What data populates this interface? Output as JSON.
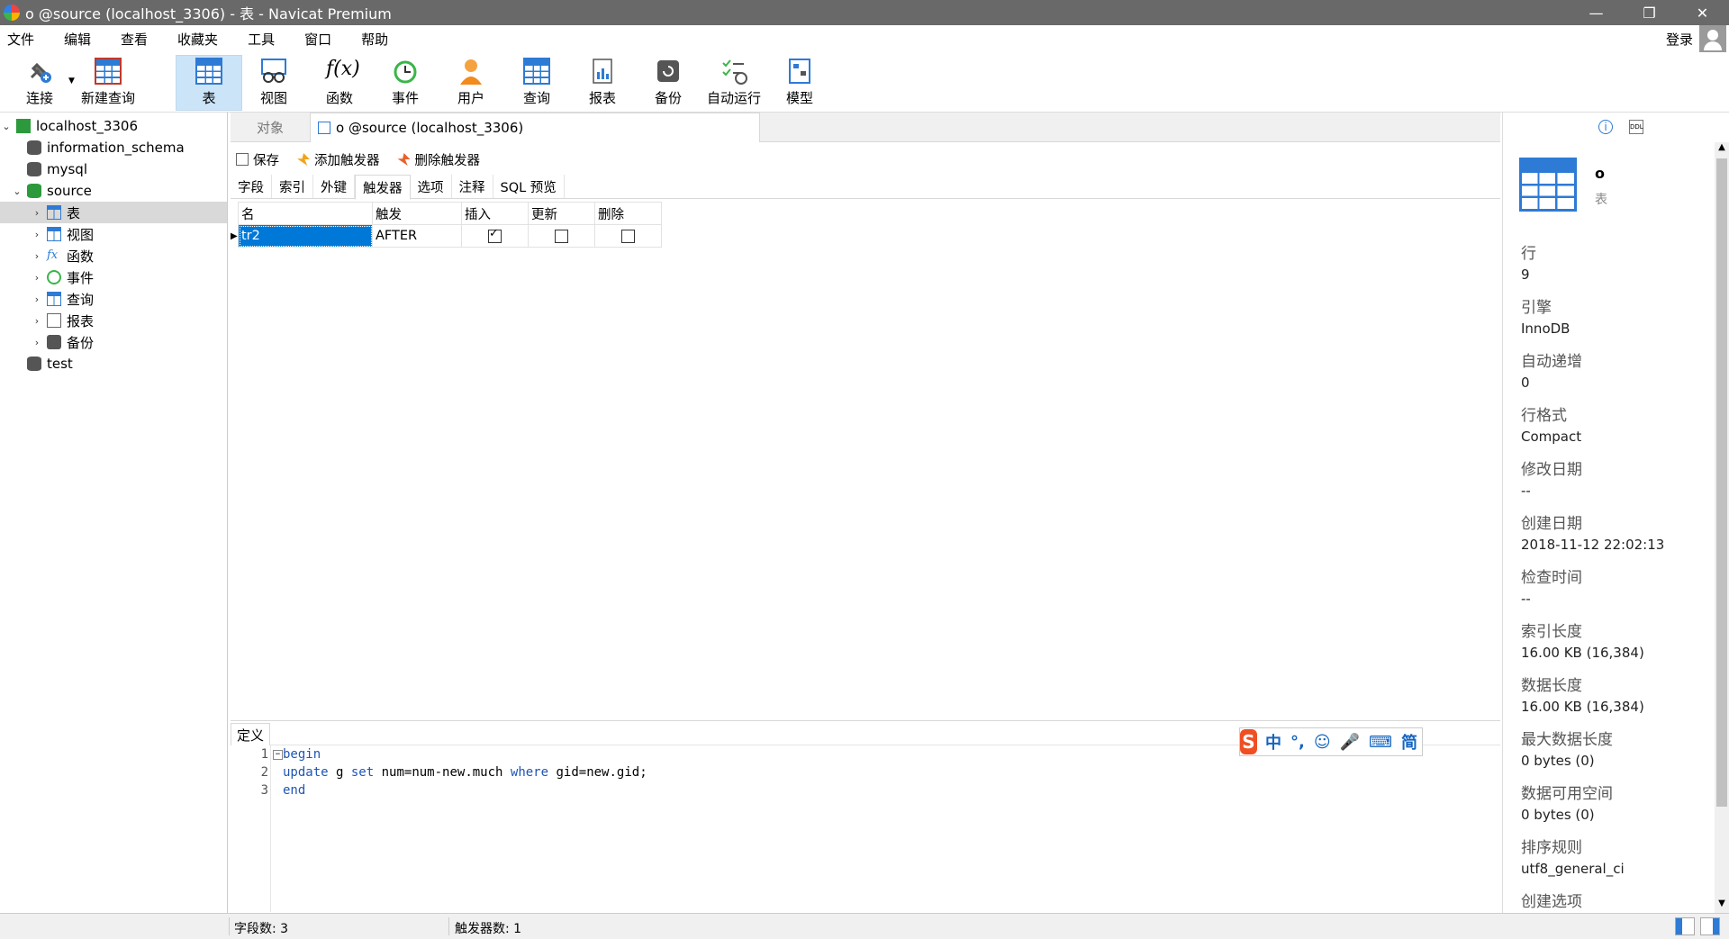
{
  "window": {
    "title": "o @source (localhost_3306) - 表 - Navicat Premium",
    "controls": [
      "—",
      "❐",
      "✕"
    ]
  },
  "menu": {
    "items": [
      "文件",
      "编辑",
      "查看",
      "收藏夹",
      "工具",
      "窗口",
      "帮助"
    ],
    "login": "登录"
  },
  "toolbar": {
    "items": [
      {
        "label": "连接",
        "icon": "connect-icon"
      },
      {
        "label": "新建查询",
        "icon": "new-query-icon"
      },
      {
        "label": "表",
        "icon": "table-icon",
        "active": true
      },
      {
        "label": "视图",
        "icon": "view-icon"
      },
      {
        "label": "函数",
        "icon": "function-icon"
      },
      {
        "label": "事件",
        "icon": "event-icon"
      },
      {
        "label": "用户",
        "icon": "user-icon"
      },
      {
        "label": "查询",
        "icon": "query-icon"
      },
      {
        "label": "报表",
        "icon": "report-icon"
      },
      {
        "label": "备份",
        "icon": "backup-icon"
      },
      {
        "label": "自动运行",
        "icon": "automation-icon"
      },
      {
        "label": "模型",
        "icon": "model-icon"
      }
    ]
  },
  "nav": {
    "connection": "localhost_3306",
    "databases": [
      "information_schema",
      "mysql",
      "source"
    ],
    "source_children": [
      "表",
      "视图",
      "函数",
      "事件",
      "查询",
      "报表",
      "备份"
    ],
    "last_db": "test"
  },
  "tabs": {
    "objects": "对象",
    "document": "o @source (localhost_3306)"
  },
  "actions": {
    "save": "保存",
    "add_trigger": "添加触发器",
    "delete_trigger": "删除触发器"
  },
  "subtabs": [
    "字段",
    "索引",
    "外键",
    "触发器",
    "选项",
    "注释",
    "SQL 预览"
  ],
  "subtab_active": "触发器",
  "trigger_table": {
    "headers": [
      "名",
      "触发",
      "插入",
      "更新",
      "删除"
    ],
    "rows": [
      {
        "name": "tr2",
        "timing": "AFTER",
        "insert": true,
        "update": false,
        "delete": false
      }
    ]
  },
  "definition": {
    "tab": "定义",
    "lines": [
      {
        "no": "1",
        "parts": [
          [
            "kw",
            "begin"
          ]
        ]
      },
      {
        "no": "2",
        "parts": [
          [
            "kw",
            "update"
          ],
          [
            "",
            " g "
          ],
          [
            "kw",
            "set"
          ],
          [
            "",
            " num=num-new.much "
          ],
          [
            "kw",
            "where"
          ],
          [
            "",
            " gid=new.gid;"
          ]
        ]
      },
      {
        "no": "3",
        "parts": [
          [
            "kw",
            "end"
          ]
        ]
      }
    ]
  },
  "ime": {
    "logo": "S",
    "glyphs": [
      "中",
      "°,",
      "☺",
      "🎤",
      "⌨",
      "简"
    ]
  },
  "info": {
    "name": "o",
    "type": "表",
    "props": [
      {
        "label": "行",
        "value": "9"
      },
      {
        "label": "引擎",
        "value": "InnoDB"
      },
      {
        "label": "自动递增",
        "value": "0"
      },
      {
        "label": "行格式",
        "value": "Compact"
      },
      {
        "label": "修改日期",
        "value": "--"
      },
      {
        "label": "创建日期",
        "value": "2018-11-12 22:02:13"
      },
      {
        "label": "检查时间",
        "value": "--"
      },
      {
        "label": "索引长度",
        "value": "16.00 KB (16,384)"
      },
      {
        "label": "数据长度",
        "value": "16.00 KB (16,384)"
      },
      {
        "label": "最大数据长度",
        "value": "0 bytes (0)"
      },
      {
        "label": "数据可用空间",
        "value": "0 bytes (0)"
      },
      {
        "label": "排序规则",
        "value": "utf8_general_ci"
      },
      {
        "label": "创建选项",
        "value": ""
      }
    ]
  },
  "status": {
    "fields_count": "字段数: 3",
    "triggers_count": "触发器数: 1"
  },
  "colors": {
    "accent": "#2d7bd4",
    "selection": "#0078d7",
    "titlebar": "#696969",
    "toolbar_active": "#cce4f7",
    "keyword": "#1f55b5"
  }
}
